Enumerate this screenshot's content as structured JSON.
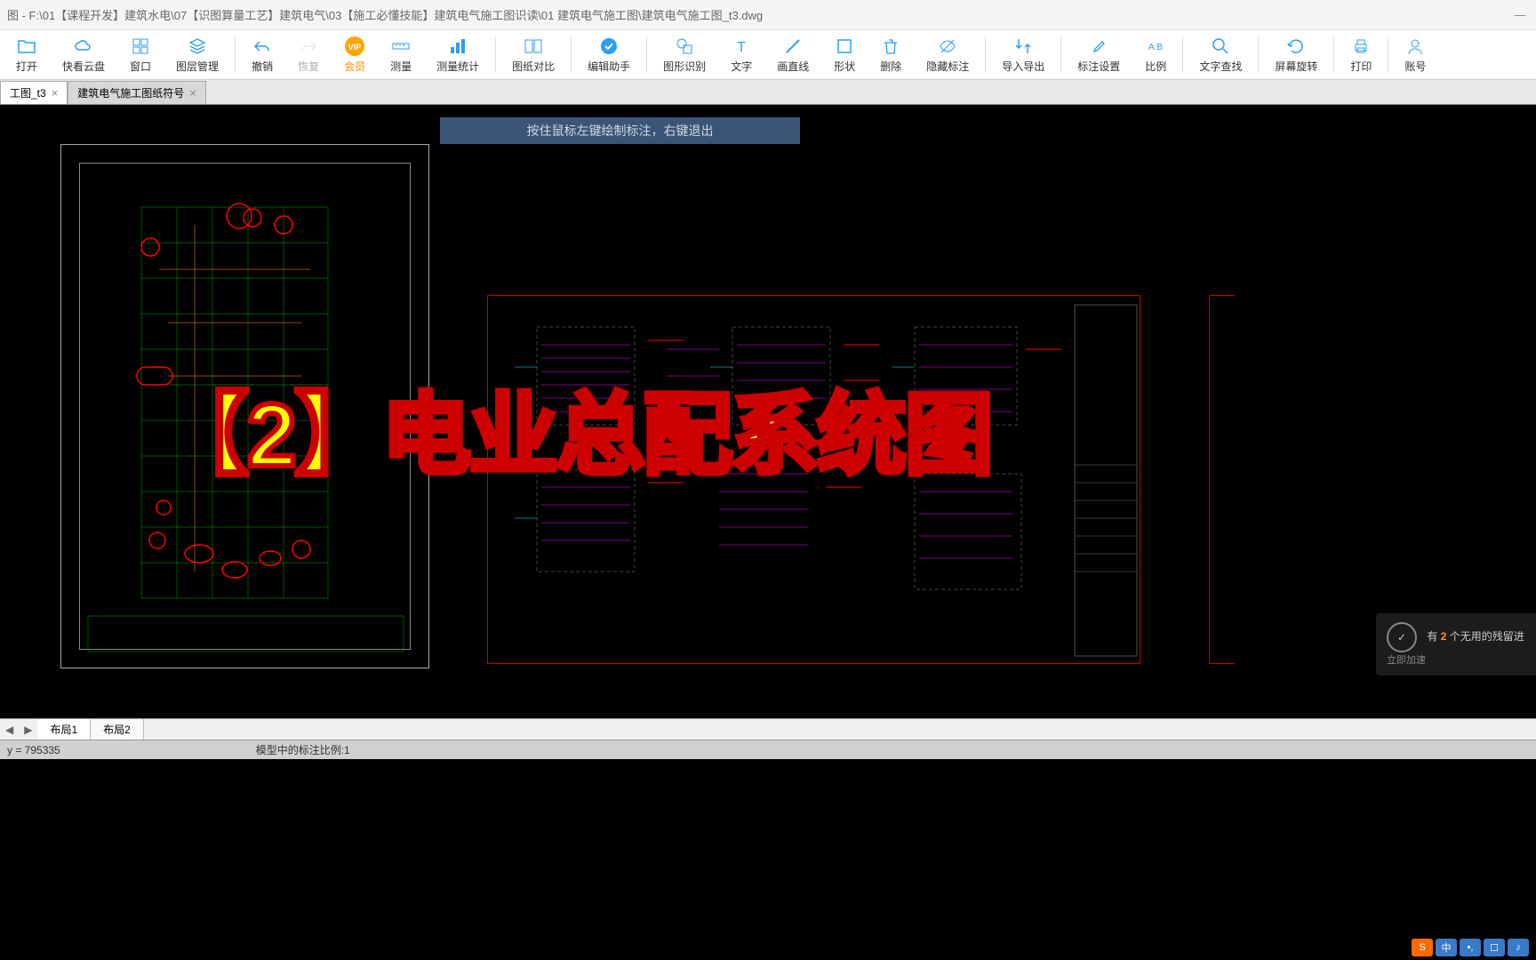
{
  "window": {
    "title": "图 - F:\\01【课程开发】建筑水电\\07【识图算量工艺】建筑电气\\03【施工必懂技能】建筑电气施工图识读\\01  建筑电气施工图\\建筑电气施工图_t3.dwg",
    "min": "—",
    "max": "☐",
    "close": "✕"
  },
  "toolbar": [
    {
      "label": "打开",
      "icon": "folder"
    },
    {
      "label": "快看云盘",
      "icon": "cloud"
    },
    {
      "label": "窗口",
      "icon": "windows"
    },
    {
      "label": "图层管理",
      "icon": "layers"
    },
    {
      "sep": true
    },
    {
      "label": "撤销",
      "icon": "undo"
    },
    {
      "label": "恢复",
      "icon": "redo",
      "disabled": true
    },
    {
      "label": "会员",
      "icon": "vip",
      "vip": true
    },
    {
      "label": "测量",
      "icon": "ruler"
    },
    {
      "label": "测量统计",
      "icon": "stats"
    },
    {
      "sep": true
    },
    {
      "label": "图纸对比",
      "icon": "compare"
    },
    {
      "sep": true
    },
    {
      "label": "编辑助手",
      "icon": "edit-assist"
    },
    {
      "sep": true
    },
    {
      "label": "图形识别",
      "icon": "shape-detect"
    },
    {
      "label": "文字",
      "icon": "text"
    },
    {
      "label": "画直线",
      "icon": "line"
    },
    {
      "label": "形状",
      "icon": "shape"
    },
    {
      "label": "删除",
      "icon": "delete"
    },
    {
      "label": "隐藏标注",
      "icon": "hide-anno"
    },
    {
      "sep": true
    },
    {
      "label": "导入导出",
      "icon": "import-export"
    },
    {
      "sep": true
    },
    {
      "label": "标注设置",
      "icon": "anno-settings"
    },
    {
      "label": "比例",
      "icon": "scale"
    },
    {
      "sep": true
    },
    {
      "label": "文字查找",
      "icon": "find-text"
    },
    {
      "sep": true
    },
    {
      "label": "屏幕旋转",
      "icon": "rotate"
    },
    {
      "sep": true
    },
    {
      "label": "打印",
      "icon": "print"
    },
    {
      "sep": true
    },
    {
      "label": "账号",
      "icon": "account"
    }
  ],
  "tabs": [
    {
      "label": "工图_t3",
      "active": true
    },
    {
      "label": "建筑电气施工图纸符号",
      "active": false
    }
  ],
  "hint": "按住鼠标左键绘制标注，右键退出",
  "overlay": "【2】电业总配系统图",
  "layout_tabs": {
    "nav_left": "◀",
    "nav_right": "▶",
    "items": [
      "布局1",
      "布局2"
    ]
  },
  "status": {
    "coord": "y = 795335",
    "scale_label": "模型中的标注比例:1"
  },
  "notification": {
    "count": "2",
    "line1_a": "有 ",
    "line1_b": " 个无用的残留进",
    "line2": "立即加速"
  },
  "ime": [
    "S",
    "中",
    "•,",
    "☐",
    "♪"
  ]
}
